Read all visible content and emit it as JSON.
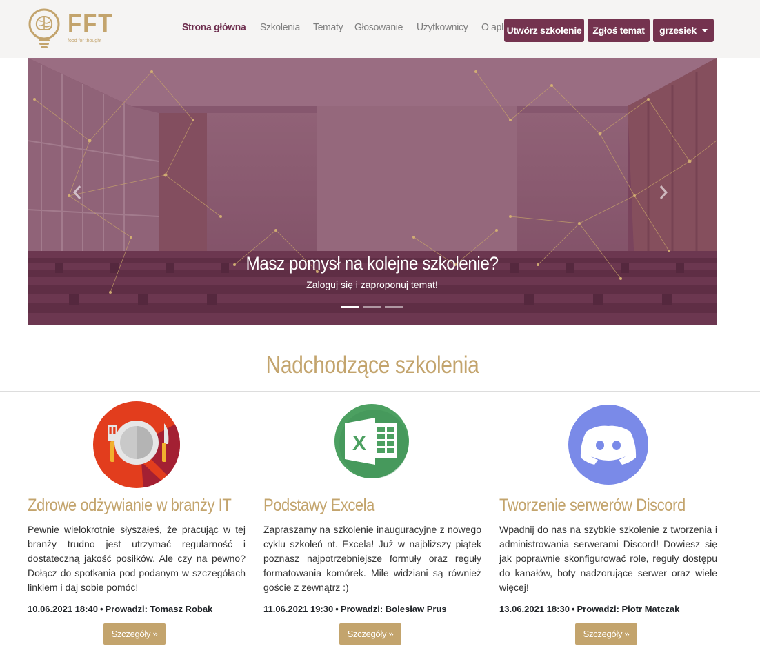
{
  "brand": {
    "name": "FFT",
    "tagline": "food for thought",
    "color": "#c3a46d"
  },
  "nav": {
    "links": [
      {
        "label": "Strona główna",
        "active": true
      },
      {
        "label": "Szkolenia"
      },
      {
        "label": "Tematy"
      },
      {
        "label": "Głosowanie"
      },
      {
        "label": "Użytkownicy"
      },
      {
        "label": "O aplikacji"
      }
    ],
    "create_label": "Utwórz szkolenie",
    "report_label": "Zgłoś temat",
    "user_label": "grzesiek",
    "accent": "#74334f"
  },
  "carousel": {
    "title": "Masz pomysł na kolejne szkolenie?",
    "subtitle": "Zaloguj się i zaproponuj temat!",
    "slides_count": 3,
    "active_slide": 1
  },
  "section": {
    "title": "Nadchodzące szkolenia"
  },
  "courses": [
    {
      "icon": "plate-cutlery-icon",
      "title": "Zdrowe odżywianie w branży IT",
      "description": "Pewnie wielokrotnie słyszałeś, że pracując w tej branży trudno jest utrzymać regularność i dostateczną jakość posiłków. Ale czy na pewno? Dołącz do spotkania pod podanym w szczegółach linkiem i daj sobie pomóc!",
      "date": "10.06.2021 18:40",
      "host_label": "Prowadzi: Tomasz Robak",
      "button": "Szczegóły »"
    },
    {
      "icon": "excel-icon",
      "title": "Podstawy Excela",
      "description": "Zapraszamy na szkolenie inauguracyjne z nowego cyklu szkoleń nt. Excela! Już w najbliższy piątek poznasz najpotrzebniejsze formuły oraz reguły formatowania komórek. Mile widziani są również goście z zewnątrz :)",
      "date": "11.06.2021 19:30",
      "host_label": "Prowadzi: Bolesław Prus",
      "button": "Szczegóły »"
    },
    {
      "icon": "discord-icon",
      "title": "Tworzenie serwerów Discord",
      "description": "Wpadnij do nas na szybkie szkolenie z tworzenia i administrowania serwerami Discord! Dowiesz się jak poprawnie skonfigurować role, reguły dostępu do kanałów, boty nadzorujące serwer oraz wiele więcej!",
      "date": "13.06.2021 18:30",
      "host_label": "Prowadzi: Piotr Matczak",
      "button": "Szczegóły »"
    }
  ]
}
